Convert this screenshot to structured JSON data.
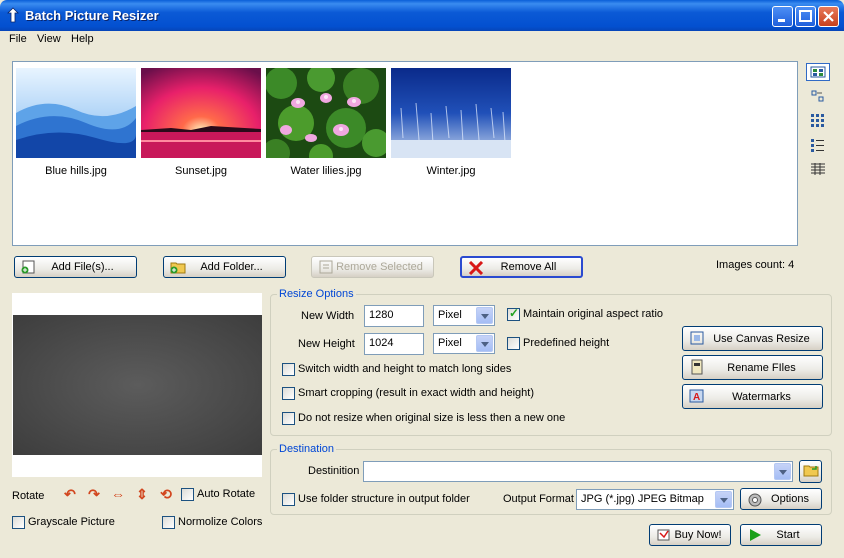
{
  "window": {
    "title": "Batch Picture Resizer"
  },
  "menu": [
    "File",
    "View",
    "Help"
  ],
  "images": [
    {
      "name": "Blue hills.jpg"
    },
    {
      "name": "Sunset.jpg"
    },
    {
      "name": "Water lilies.jpg"
    },
    {
      "name": "Winter.jpg"
    }
  ],
  "toolbar": {
    "add_files": "Add File(s)...",
    "add_folder": "Add Folder...",
    "remove_selected": "Remove Selected",
    "remove_all": "Remove All",
    "images_count": "Images count: 4"
  },
  "resize": {
    "legend": "Resize Options",
    "width_label": "New Width",
    "width_value": "1280",
    "width_unit": "Pixel",
    "height_label": "New Height",
    "height_value": "1024",
    "height_unit": "Pixel",
    "maintain_aspect": "Maintain original aspect ratio",
    "predefined_height": "Predefined height",
    "switch_sides": "Switch width and height to match long sides",
    "smart_crop": "Smart cropping (result in exact width and height)",
    "no_resize_smaller": "Do not resize when original size is less then a new one"
  },
  "side_buttons": {
    "canvas": "Use Canvas Resize",
    "rename": "Rename FIles",
    "watermarks": "Watermarks"
  },
  "destination": {
    "legend": "Destination",
    "label": "Destinition",
    "value": "",
    "use_folder_structure": "Use folder structure in output folder",
    "format_label": "Output Format",
    "format_value": "JPG (*.jpg) JPEG Bitmap",
    "options": "Options"
  },
  "preview": {
    "rotate_label": "Rotate",
    "auto_rotate": "Auto Rotate",
    "grayscale": "Grayscale Picture",
    "normalize": "Normolize Colors"
  },
  "footer": {
    "buy": "Buy Now!",
    "start": "Start"
  }
}
